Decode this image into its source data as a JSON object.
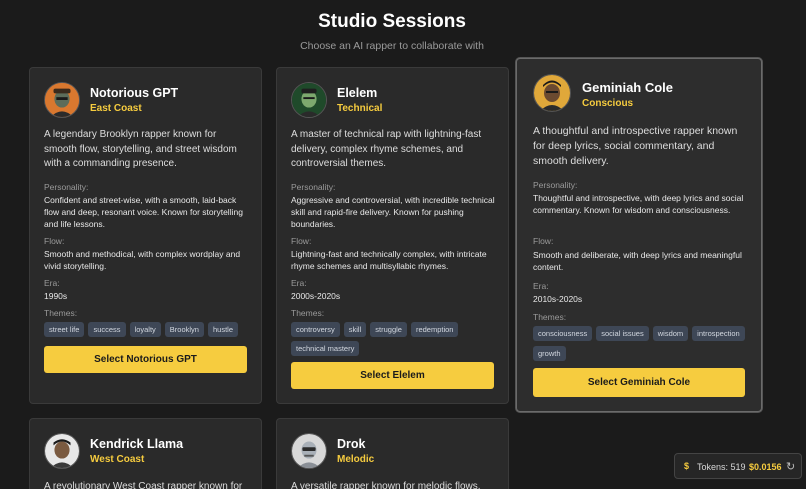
{
  "header": {
    "title": "Studio Sessions",
    "subtitle": "Choose an AI rapper to collaborate with"
  },
  "labels": {
    "personality": "Personality:",
    "flow": "Flow:",
    "era": "Era:",
    "themes": "Themes:"
  },
  "rappers": [
    {
      "name": "Notorious GPT",
      "region": "East Coast",
      "description": "A legendary Brooklyn rapper known for smooth flow, storytelling, and street wisdom with a commanding presence.",
      "personality": "Confident and street-wise, with a smooth, laid-back flow and deep, resonant voice. Known for storytelling and life lessons.",
      "flow": "Smooth and methodical, with complex wordplay and vivid storytelling.",
      "era": "1990s",
      "themes": [
        "street life",
        "success",
        "loyalty",
        "Brooklyn",
        "hustle"
      ],
      "button": "Select Notorious GPT",
      "avatar_icon": "rapper-avatar-icon",
      "selected": false
    },
    {
      "name": "Elelem",
      "region": "Technical",
      "description": "A master of technical rap with lightning-fast delivery, complex rhyme schemes, and controversial themes.",
      "personality": "Aggressive and controversial, with incredible technical skill and rapid-fire delivery. Known for pushing boundaries.",
      "flow": "Lightning-fast and technically complex, with intricate rhyme schemes and multisyllabic rhymes.",
      "era": "2000s-2020s",
      "themes": [
        "controversy",
        "skill",
        "struggle",
        "redemption",
        "technical mastery"
      ],
      "button": "Select Elelem",
      "avatar_icon": "rapper-avatar-icon",
      "selected": false
    },
    {
      "name": "Geminiah Cole",
      "region": "Conscious",
      "description": "A thoughtful and introspective rapper known for deep lyrics, social commentary, and smooth delivery.",
      "personality": "Thoughtful and introspective, with deep lyrics and social commentary. Known for wisdom and consciousness.",
      "flow": "Smooth and deliberate, with deep lyrics and meaningful content.",
      "era": "2010s-2020s",
      "themes": [
        "consciousness",
        "social issues",
        "wisdom",
        "introspection",
        "growth"
      ],
      "button": "Select Geminiah Cole",
      "avatar_icon": "rapper-avatar-icon",
      "selected": true
    },
    {
      "name": "Kendrick Llama",
      "region": "West Coast",
      "description": "A revolutionary West Coast rapper known for",
      "avatar_icon": "rapper-avatar-icon"
    },
    {
      "name": "Drok",
      "region": "Melodic",
      "description": "A versatile rapper known for melodic flows,",
      "avatar_icon": "robot-avatar-icon"
    }
  ],
  "token_bar": {
    "icon": "dollar-icon",
    "tokens_text": "Tokens: 519",
    "cost": "$0.0156",
    "reset_icon": "refresh-icon"
  },
  "colors": {
    "background": "#1b1b1b",
    "card": "#2a2a2a",
    "accent": "#f6cc3f",
    "tag": "#3e4756"
  }
}
